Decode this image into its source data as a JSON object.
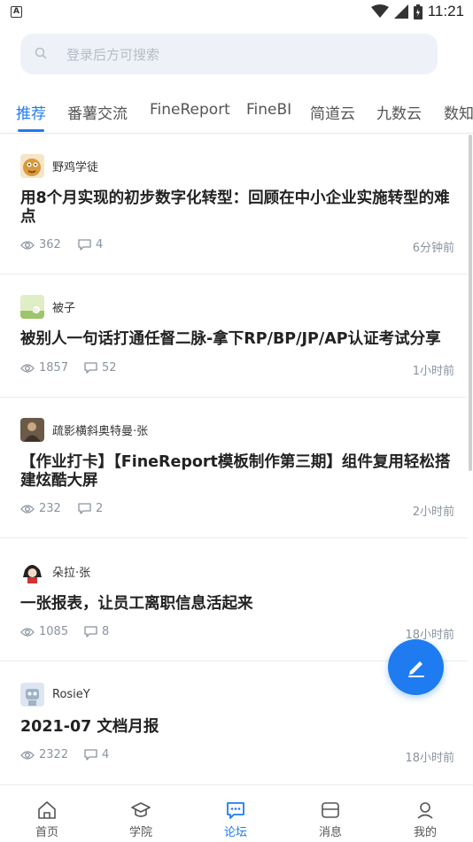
{
  "status_bar": {
    "time": "11:21",
    "notification_badge": "A"
  },
  "search": {
    "placeholder": "登录后方可搜索"
  },
  "tabs": [
    {
      "label": "推荐",
      "active": true
    },
    {
      "label": "番薯交流"
    },
    {
      "label": "FineReport"
    },
    {
      "label": "FineBI"
    },
    {
      "label": "简道云"
    },
    {
      "label": "九数云"
    },
    {
      "label": "数知"
    }
  ],
  "posts": [
    {
      "author": "野鸡学徒",
      "title": "用8个月实现的初步数字化转型：回顾在中小企业实施转型的难点",
      "views": "362",
      "comments": "4",
      "time": "6分钟前"
    },
    {
      "author": "被子",
      "title": "被别人一句话打通任督二脉-拿下RP/BP/JP/AP认证考试分享",
      "views": "1857",
      "comments": "52",
      "time": "1小时前"
    },
    {
      "author": "疏影横斜奥特曼·张",
      "title": "【作业打卡】【FineReport模板制作第三期】组件复用轻松搭建炫酷大屏",
      "views": "232",
      "comments": "2",
      "time": "2小时前"
    },
    {
      "author": "朵拉·张",
      "title": "一张报表，让员工离职信息活起来",
      "views": "1085",
      "comments": "8",
      "time": "18小时前"
    },
    {
      "author": "RosieY",
      "title": "2021-07 文档月报",
      "views": "2322",
      "comments": "4",
      "time": "18小时前"
    }
  ],
  "bottom_nav": [
    {
      "label": "首页",
      "icon": "home-icon"
    },
    {
      "label": "学院",
      "icon": "academy-icon"
    },
    {
      "label": "论坛",
      "icon": "forum-icon",
      "active": true
    },
    {
      "label": "消息",
      "icon": "message-icon"
    },
    {
      "label": "我的",
      "icon": "profile-icon"
    }
  ],
  "colors": {
    "accent": "#1e7cf0",
    "muted": "#8a93a0"
  }
}
